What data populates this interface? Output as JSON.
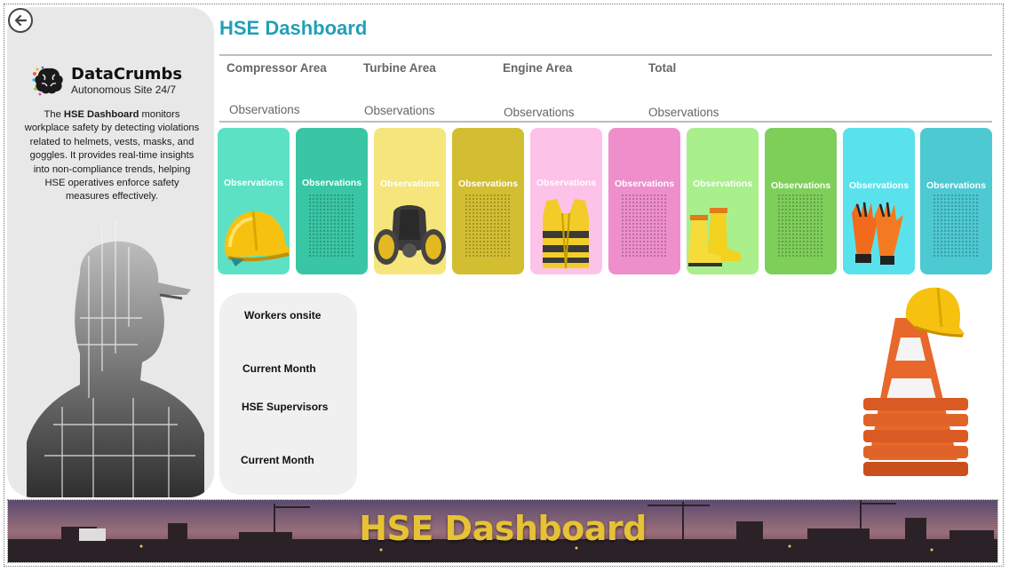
{
  "header": {
    "title": "HSE Dashboard"
  },
  "navigation": {
    "back_icon": "arrow-left-circle-icon"
  },
  "sidebar": {
    "logo": {
      "name": "DataCrumbs",
      "tagline": "Autonomous Site 24/7"
    },
    "description": {
      "prefix": "The ",
      "bold": "HSE Dashboard",
      "suffix": " monitors workplace safety by detecting violations related to helmets, vests, masks, and goggles. It provides real-time insights into non-compliance trends, helping HSE operatives enforce safety measures effectively."
    }
  },
  "areas": [
    {
      "name": "Compressor Area",
      "metric": "Observations"
    },
    {
      "name": "Turbine Area",
      "metric": "Observations"
    },
    {
      "name": "Engine Area",
      "metric": "Observations"
    },
    {
      "name": "Total",
      "metric": "Observations"
    }
  ],
  "cards": [
    {
      "label": "Observations",
      "color": "#5de1c4",
      "icon": "helmet-icon"
    },
    {
      "label": "Observations",
      "color": "#39c6a4",
      "icon": ""
    },
    {
      "label": "Observations",
      "color": "#f6e57a",
      "icon": "gas-mask-icon"
    },
    {
      "label": "Observations",
      "color": "#d3be31",
      "icon": ""
    },
    {
      "label": "Observations",
      "color": "#fdc2e8",
      "icon": "safety-vest-icon"
    },
    {
      "label": "Observations",
      "color": "#ee8fcc",
      "icon": ""
    },
    {
      "label": "Observations",
      "color": "#a9ef8c",
      "icon": "safety-boots-icon"
    },
    {
      "label": "Observations",
      "color": "#7ecf5a",
      "icon": ""
    },
    {
      "label": "Observations",
      "color": "#5ae2ec",
      "icon": "safety-gloves-icon"
    },
    {
      "label": "Observations",
      "color": "#4dc9d2",
      "icon": ""
    }
  ],
  "workers_panel": {
    "workers_onsite": "Workers onsite",
    "current_month_1": "Current Month",
    "hse_supervisors": "HSE Supervisors",
    "current_month_2": "Current Month"
  },
  "banner": {
    "title": "HSE Dashboard"
  }
}
